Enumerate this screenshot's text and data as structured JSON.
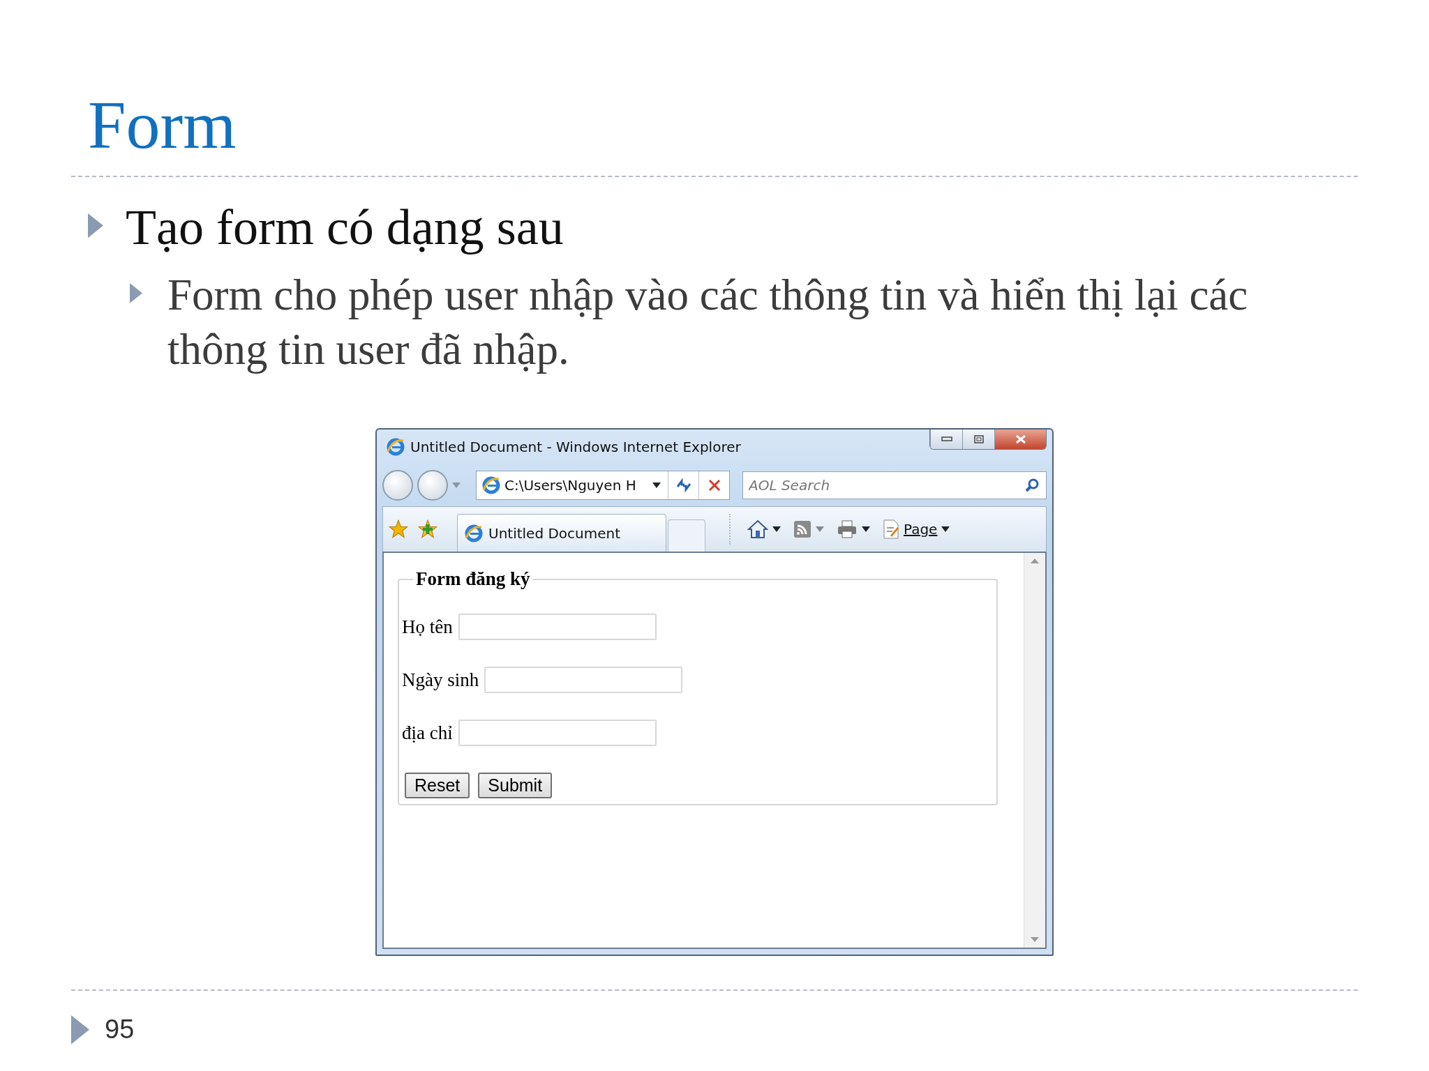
{
  "slide": {
    "title": "Form",
    "bullets": [
      {
        "text": "Tạo form có dạng sau",
        "children": [
          {
            "text": "Form cho phép user nhập vào các thông tin và hiển thị lại các thông tin user đã nhập."
          }
        ]
      }
    ],
    "page_number": "95"
  },
  "browser": {
    "title": "Untitled Document - Windows Internet Explorer",
    "address": "C:\\Users\\Nguyen H",
    "search_placeholder": "AOL Search",
    "tab": "Untitled Document",
    "commands": [
      {
        "kind": "home"
      },
      {
        "kind": "feed"
      },
      {
        "kind": "print"
      },
      {
        "kind": "page",
        "label": "Page"
      }
    ],
    "form": {
      "legend": "Form đăng ký",
      "fields": [
        {
          "label": "Họ tên"
        },
        {
          "label": "Ngày sinh"
        },
        {
          "label": "địa chỉ"
        }
      ],
      "buttons": [
        "Reset",
        "Submit"
      ]
    }
  }
}
